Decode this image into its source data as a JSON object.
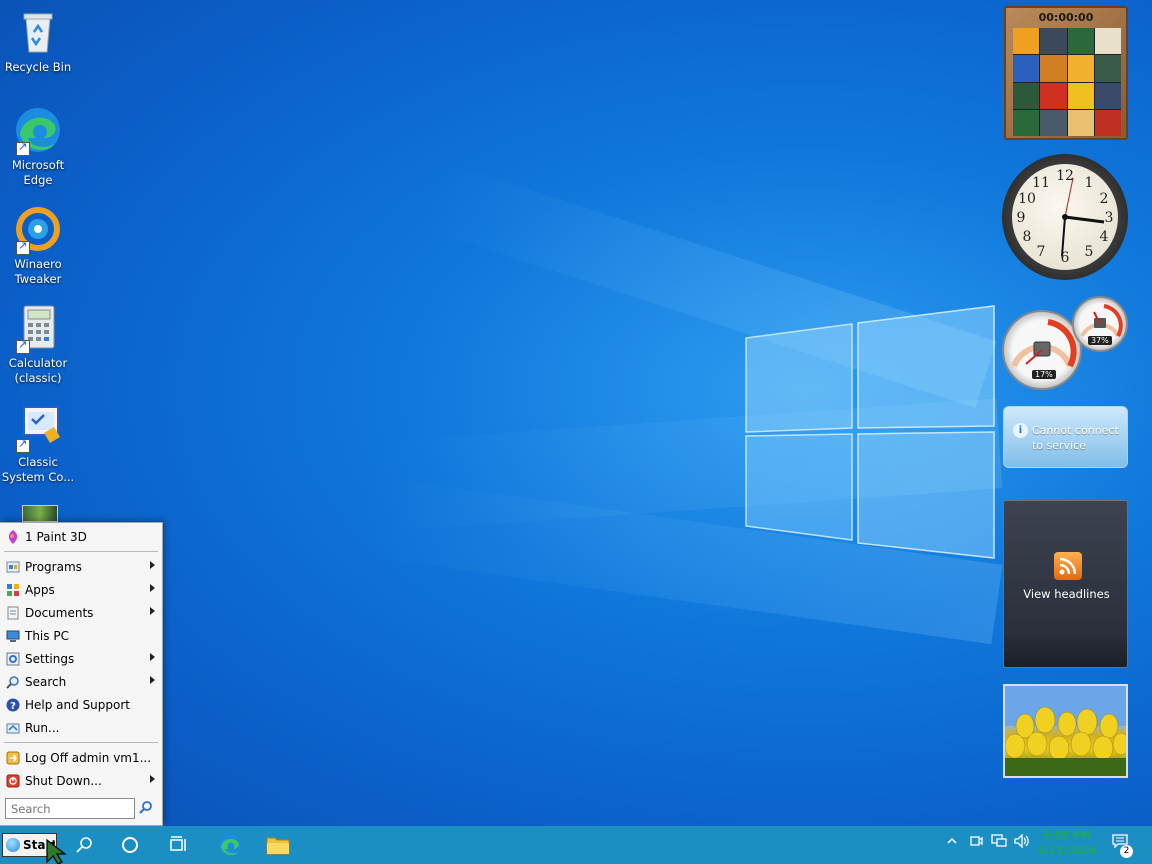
{
  "desktop": {
    "icons": [
      {
        "label_line1": "Recycle Bin",
        "label_line2": ""
      },
      {
        "label_line1": "Microsoft",
        "label_line2": "Edge"
      },
      {
        "label_line1": "Winaero",
        "label_line2": "Tweaker"
      },
      {
        "label_line1": "Calculator",
        "label_line2": "(classic)"
      },
      {
        "label_line1": "Classic",
        "label_line2": "System Co..."
      }
    ]
  },
  "start_menu": {
    "pinned": "1 Paint 3D",
    "items": [
      {
        "label": "Programs",
        "icon": "programs-icon"
      },
      {
        "label": "Apps",
        "icon": "apps-icon"
      },
      {
        "label": "Documents",
        "icon": "documents-icon"
      },
      {
        "label": "This PC",
        "icon": "computer-icon"
      },
      {
        "label": "Settings",
        "icon": "settings-icon"
      },
      {
        "label": "Search",
        "icon": "search-icon"
      },
      {
        "label": "Help and Support",
        "icon": "help-icon"
      },
      {
        "label": "Run...",
        "icon": "run-icon"
      }
    ],
    "logoff": "Log Off admin vm1...",
    "shutdown": "Shut Down...",
    "search_placeholder": "Search"
  },
  "taskbar": {
    "start_label": "Start",
    "clock_time": "5:09 PM",
    "clock_date": "6/15/2024",
    "notification_count": "2"
  },
  "gadgets": {
    "puzzle_timer": "00:00:00",
    "cpu_percent": "17%",
    "ram_percent": "37%",
    "weather_line1": "Cannot connect",
    "weather_line2": "to service",
    "feeds_label": "View headlines",
    "clock_numbers": [
      "12",
      "1",
      "2",
      "3",
      "4",
      "5",
      "6",
      "7",
      "8",
      "9",
      "10",
      "11"
    ]
  },
  "colors": {
    "taskbar": "#1b8fc4",
    "wallpaper": "#0f78dc",
    "clock_text": "#1aa85a"
  }
}
